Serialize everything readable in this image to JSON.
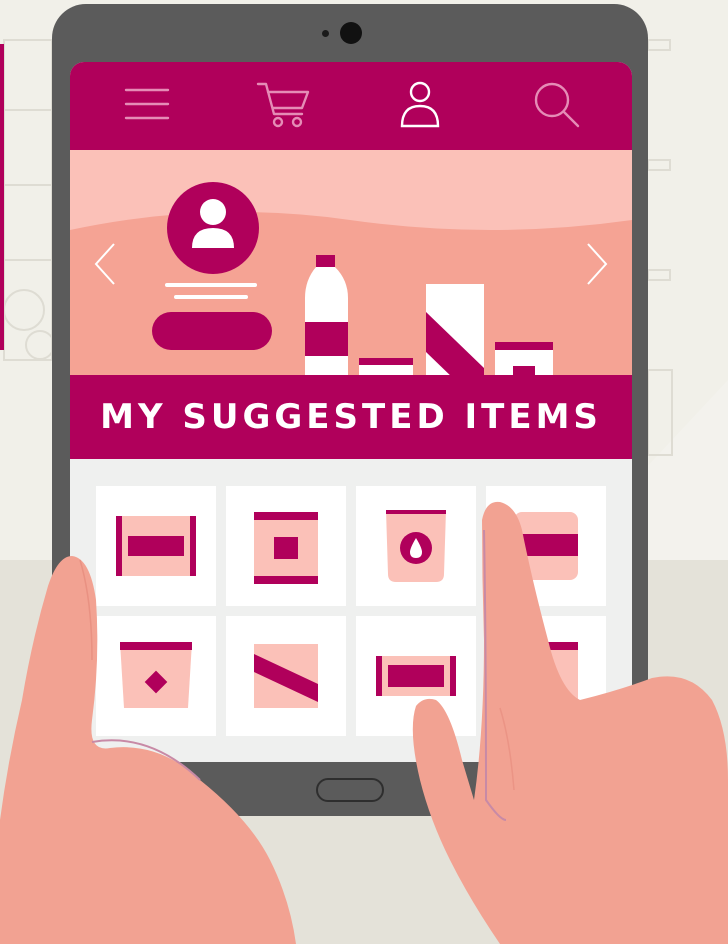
{
  "colors": {
    "brand_magenta": "#b0005b",
    "banner_pink": "#fbc1b8",
    "banner_salmon": "#f5a394",
    "background": "#eeece4",
    "tablet_frame": "#5b5b5b",
    "skin": "#f2a292"
  },
  "nav": {
    "items": [
      {
        "icon": "menu-icon"
      },
      {
        "icon": "cart-icon"
      },
      {
        "icon": "user-icon"
      },
      {
        "icon": "search-icon"
      }
    ]
  },
  "banner": {
    "left_arrow_icon": "chevron-left-icon",
    "right_arrow_icon": "chevron-right-icon",
    "profile_icon": "user-avatar-icon"
  },
  "section": {
    "title": "MY SUGGESTED ITEMS"
  },
  "grid": {
    "items": [
      {
        "icon": "snack-bar-icon"
      },
      {
        "icon": "chip-bag-icon"
      },
      {
        "icon": "pouch-drop-icon"
      },
      {
        "icon": "package-icon"
      },
      {
        "icon": "tub-diamond-icon"
      },
      {
        "icon": "box-stripe-icon"
      },
      {
        "icon": "snack-bar-icon"
      },
      {
        "icon": "package-icon"
      }
    ]
  }
}
